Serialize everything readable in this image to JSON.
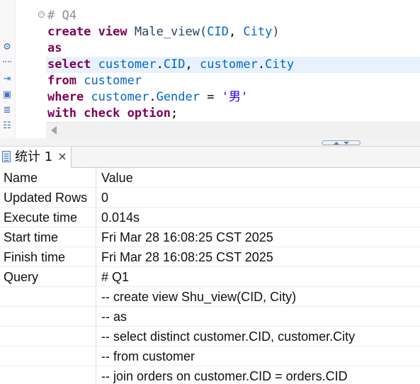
{
  "editor": {
    "fold_marker": "−",
    "lines": [
      [
        {
          "text": "# Q4",
          "type": "cmt"
        }
      ],
      [
        {
          "text": "create",
          "type": "kw"
        },
        {
          "text": " ",
          "type": "op"
        },
        {
          "text": "view",
          "type": "kw"
        },
        {
          "text": " Male_view(",
          "type": "id"
        },
        {
          "text": "CID",
          "type": "col"
        },
        {
          "text": ", ",
          "type": "op"
        },
        {
          "text": "City",
          "type": "col"
        },
        {
          "text": ")",
          "type": "id"
        }
      ],
      [
        {
          "text": "as",
          "type": "kw"
        }
      ],
      [
        {
          "text": "select",
          "type": "kw"
        },
        {
          "text": " ",
          "type": "op"
        },
        {
          "text": "customer",
          "type": "col"
        },
        {
          "text": ".",
          "type": "op"
        },
        {
          "text": "CID",
          "type": "col"
        },
        {
          "text": ", ",
          "type": "op"
        },
        {
          "text": "customer",
          "type": "col"
        },
        {
          "text": ".",
          "type": "op"
        },
        {
          "text": "City",
          "type": "col"
        }
      ],
      [
        {
          "text": "from",
          "type": "kw"
        },
        {
          "text": " ",
          "type": "op"
        },
        {
          "text": "customer",
          "type": "col"
        }
      ],
      [
        {
          "text": "where",
          "type": "kw"
        },
        {
          "text": " ",
          "type": "op"
        },
        {
          "text": "customer",
          "type": "col"
        },
        {
          "text": ".",
          "type": "op"
        },
        {
          "text": "Gender",
          "type": "col"
        },
        {
          "text": " = ",
          "type": "op"
        },
        {
          "text": "'男'",
          "type": "str"
        }
      ],
      [
        {
          "text": "with check option",
          "type": "kw"
        },
        {
          "text": ";",
          "type": "op"
        }
      ]
    ],
    "current_line": 3
  },
  "toolbar_icons": [
    {
      "name": "settings-icon",
      "glyph": "⚙"
    },
    {
      "name": "export-icon",
      "glyph": "⇥"
    },
    {
      "name": "lock-file-icon",
      "glyph": "🔒"
    },
    {
      "name": "script-icon",
      "glyph": "≣"
    },
    {
      "name": "outline-icon",
      "glyph": "☷"
    }
  ],
  "results_tab": {
    "label": "统计 1",
    "close_glyph": "×"
  },
  "results": {
    "columns": [
      "Name",
      "Value"
    ],
    "rows": [
      [
        "Updated Rows",
        "0"
      ],
      [
        "Execute time",
        "0.014s"
      ],
      [
        "Start time",
        "Fri Mar 28 16:08:25 CST 2025"
      ],
      [
        "Finish time",
        "Fri Mar 28 16:08:25 CST 2025"
      ],
      [
        "Query",
        "# Q1"
      ],
      [
        "",
        "-- create view Shu_view(CID, City)"
      ],
      [
        "",
        "-- as"
      ],
      [
        "",
        "-- select distinct customer.CID, customer.City"
      ],
      [
        "",
        "-- from customer"
      ],
      [
        "",
        "-- join orders on customer.CID = orders.CID"
      ]
    ]
  }
}
